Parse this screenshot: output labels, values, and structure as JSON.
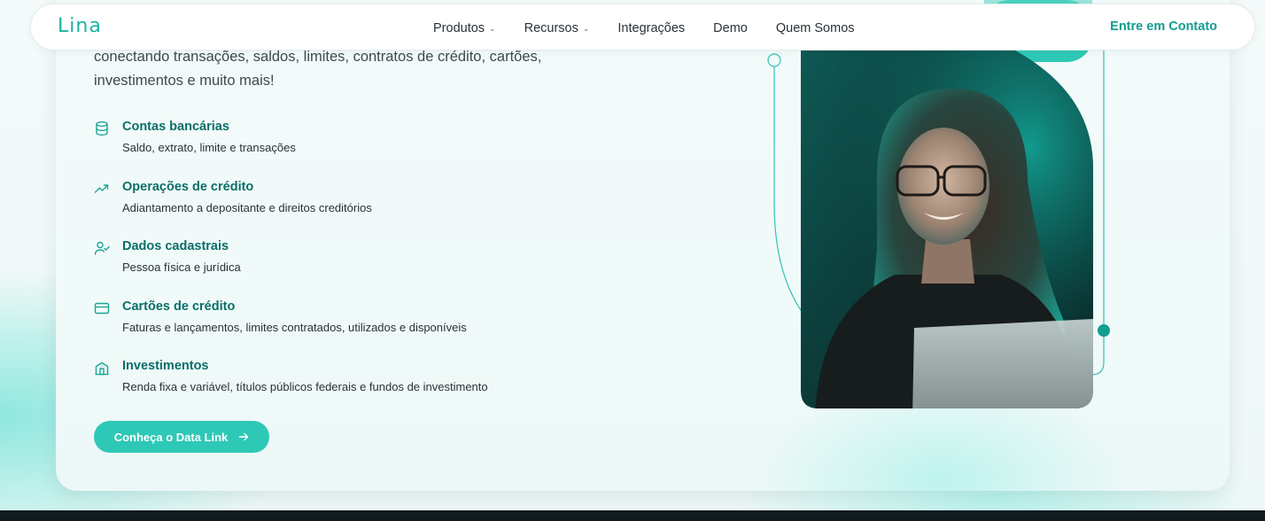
{
  "nav": {
    "logo": "Lina",
    "items": [
      {
        "label": "Produtos",
        "dropdown": true
      },
      {
        "label": "Recursos",
        "dropdown": true
      },
      {
        "label": "Integrações",
        "dropdown": false
      },
      {
        "label": "Demo",
        "dropdown": false
      },
      {
        "label": "Quem Somos",
        "dropdown": false
      }
    ],
    "contact_label": "Entre em Contato"
  },
  "intro": {
    "line1": "conectando transações, saldos, limites, contratos de crédito, cartões,",
    "line2": "investimentos e muito mais!"
  },
  "features": [
    {
      "icon": "database-icon",
      "title": "Contas bancárias",
      "desc": "Saldo, extrato, limite e transações"
    },
    {
      "icon": "trending-up-icon",
      "title": "Operações de crédito",
      "desc": "Adiantamento a depositante e direitos creditórios"
    },
    {
      "icon": "user-check-icon",
      "title": "Dados cadastrais",
      "desc": "Pessoa física e jurídica"
    },
    {
      "icon": "credit-card-icon",
      "title": "Cartões de crédito",
      "desc": "Faturas e lançamentos, limites contratados, utilizados e disponíveis"
    },
    {
      "icon": "building-icon",
      "title": "Investimentos",
      "desc": "Renda fixa e variável, títulos públicos federais e fundos de investimento"
    }
  ],
  "cta": {
    "label": "Conheça o Data Link",
    "icon": "arrow-right-icon"
  },
  "colors": {
    "accent": "#2ec8b6",
    "brand_dark": "#0b6e68",
    "link": "#119d90"
  }
}
